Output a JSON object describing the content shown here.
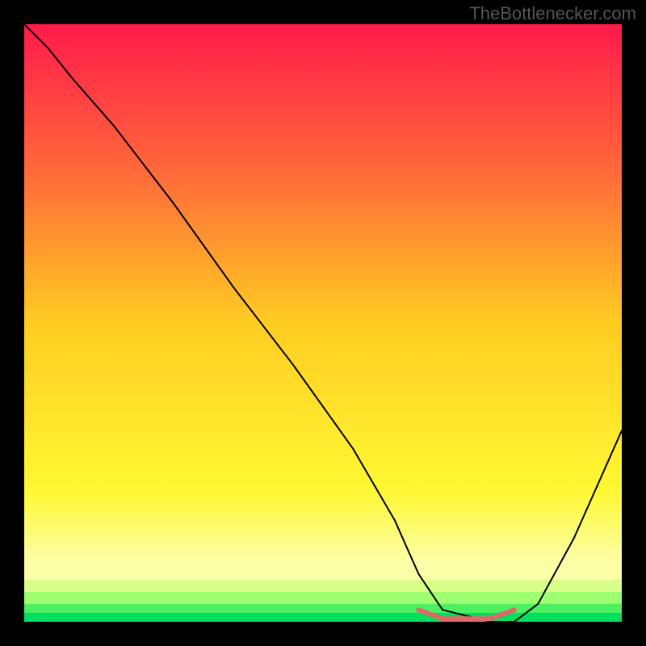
{
  "watermark": "TheBottlenecker.com",
  "chart_data": {
    "type": "line",
    "title": "",
    "xlabel": "",
    "ylabel": "",
    "xlim": [
      0,
      100
    ],
    "ylim": [
      0,
      100
    ],
    "background": {
      "type": "vertical-gradient",
      "stops": [
        {
          "pos": 0.0,
          "color": "#ff1a4a"
        },
        {
          "pos": 0.25,
          "color": "#ff6a3a"
        },
        {
          "pos": 0.5,
          "color": "#ffcc22"
        },
        {
          "pos": 0.78,
          "color": "#fff833"
        },
        {
          "pos": 0.9,
          "color": "#fdffa8"
        },
        {
          "pos": 0.96,
          "color": "#9eff70"
        },
        {
          "pos": 1.0,
          "color": "#00e060"
        }
      ]
    },
    "series": [
      {
        "name": "curve",
        "color": "#000000",
        "stroke_width": 2,
        "x": [
          0,
          4,
          8,
          15,
          25,
          35,
          45,
          55,
          62,
          66,
          70,
          78,
          82,
          86,
          92,
          100
        ],
        "y": [
          100,
          96,
          91,
          83,
          70,
          56,
          43,
          29,
          17,
          8,
          2,
          0,
          0,
          3,
          14,
          32
        ]
      },
      {
        "name": "optimal-band",
        "color": "#e06868",
        "stroke_width": 6,
        "x": [
          66,
          70,
          78,
          82
        ],
        "y": [
          2,
          0.5,
          0.5,
          2
        ]
      }
    ],
    "bottom_bands": [
      {
        "color": "#fdffa8",
        "from_y": 90,
        "to_y": 93
      },
      {
        "color": "#d8ff88",
        "from_y": 93,
        "to_y": 95
      },
      {
        "color": "#9eff70",
        "from_y": 95,
        "to_y": 97
      },
      {
        "color": "#4df060",
        "from_y": 97,
        "to_y": 98.5
      },
      {
        "color": "#00e060",
        "from_y": 98.5,
        "to_y": 100
      }
    ]
  }
}
